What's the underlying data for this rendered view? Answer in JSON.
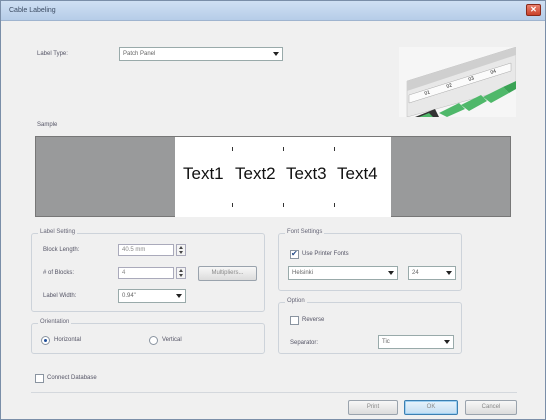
{
  "window": {
    "title": "Cable Labeling",
    "close_glyph": "✕"
  },
  "label_type": {
    "label": "Label Type:",
    "value": "Patch Panel"
  },
  "sample": {
    "label": "Sample",
    "texts": [
      "Text1",
      "Text2",
      "Text3",
      "Text4"
    ]
  },
  "label_setting": {
    "title": "Label Setting",
    "block_length": {
      "label": "Block Length:",
      "value": "40.5 mm"
    },
    "num_blocks": {
      "label": "# of Blocks:",
      "value": "4"
    },
    "multipliers_button": "Multipliers...",
    "label_width": {
      "label": "Label Width:",
      "value": "0.94\""
    }
  },
  "font_settings": {
    "title": "Font Settings",
    "use_printer_fonts": {
      "label": "Use Printer Fonts",
      "checked": true
    },
    "font_name": "Helsinki",
    "font_size": "24"
  },
  "orientation": {
    "title": "Orientation",
    "horizontal": {
      "label": "Horizontal",
      "checked": true
    },
    "vertical": {
      "label": "Vertical",
      "checked": false
    }
  },
  "option": {
    "title": "Option",
    "reverse": {
      "label": "Reverse",
      "checked": false
    },
    "separator": {
      "label": "Separator:",
      "value": "Tic"
    }
  },
  "connect_database": {
    "label": "Connect Database",
    "checked": false
  },
  "buttons": {
    "print": "Print",
    "ok": "OK",
    "cancel": "Cancel"
  },
  "thumbnail": {
    "port_labels": [
      "01",
      "02",
      "03",
      "04"
    ],
    "icon": "patch-panel-image"
  },
  "colors": {
    "preview_bg": "#999a9b",
    "cable_green": "#4fb86a",
    "titlebar": "#c3d7ee"
  }
}
